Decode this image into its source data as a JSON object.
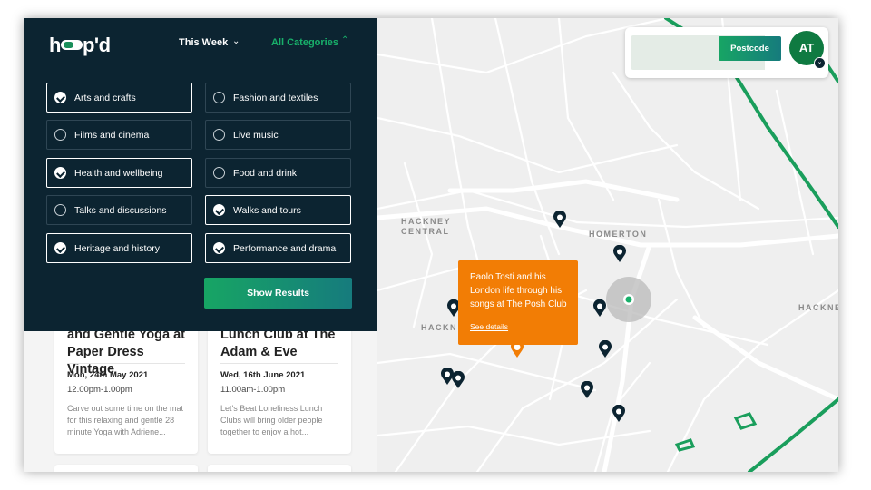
{
  "header": {
    "logo_text_left": "h",
    "logo_text_right": "p'd",
    "week_label": "This Week",
    "week_icon": "chevron-down-icon",
    "categories_label": "All Categories",
    "categories_icon": "chevron-up-icon"
  },
  "categories": [
    {
      "label": "Arts and crafts",
      "selected": true
    },
    {
      "label": "Fashion and textiles",
      "selected": false
    },
    {
      "label": "Films and cinema",
      "selected": false
    },
    {
      "label": "Live music",
      "selected": false
    },
    {
      "label": "Health and wellbeing",
      "selected": true
    },
    {
      "label": "Food and drink",
      "selected": false
    },
    {
      "label": "Talks and discussions",
      "selected": false
    },
    {
      "label": "Walks and tours",
      "selected": true
    },
    {
      "label": "Heritage and history",
      "selected": true
    },
    {
      "label": "Performance and drama",
      "selected": true
    }
  ],
  "show_results_label": "Show Results",
  "events": [
    {
      "title": "and Gentle Yoga at Paper Dress Vintage",
      "date": "Mon, 24th May 2021",
      "time": "12.00pm-1.00pm",
      "description": "Carve out some time on the mat for this relaxing and gentle 28 minute Yoga with Adriene..."
    },
    {
      "title": "Lunch Club at The Adam & Eve",
      "date": "Wed, 16th June 2021",
      "time": "11.00am-1.00pm",
      "description": "Let's Beat Loneliness Lunch Clubs will bring older people together to enjoy a hot..."
    }
  ],
  "postcode": {
    "input_value": "",
    "button_label": "Postcode"
  },
  "user": {
    "initials": "AT"
  },
  "map": {
    "areas": {
      "hackney_central": "HACKNEY CENTRAL",
      "homerton": "HOMERTON",
      "hackney_left": "HACKN",
      "hackney_right": "HACKNEY"
    },
    "popup": {
      "text": "Paolo Tosti and his London life through his songs at The Posh Club",
      "link": "See details"
    }
  },
  "colors": {
    "panel": "#0c2431",
    "accent_green": "#18b06a",
    "popup_orange": "#f27d05",
    "avatar_green": "#0f7a41"
  }
}
